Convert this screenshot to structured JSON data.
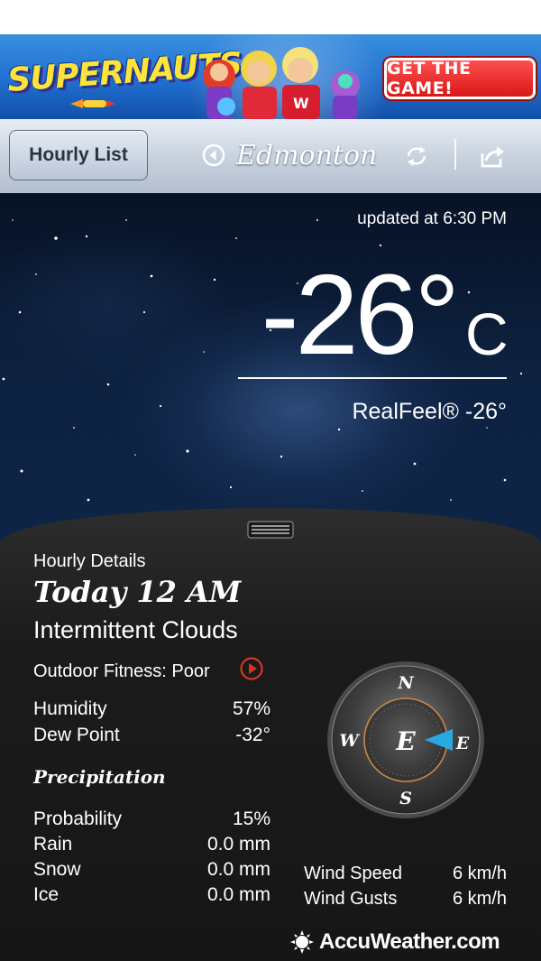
{
  "ad": {
    "brand": "SUPERNAUTS",
    "cta_label": "GET THE GAME!"
  },
  "nav": {
    "hourly_list_label": "Hourly List",
    "city": "Edmonton",
    "icons": [
      "back-icon",
      "refresh-icon",
      "share-icon"
    ]
  },
  "current": {
    "updated": "updated at 6:30 PM",
    "temperature": "-26°",
    "unit": "C",
    "realfeel": "RealFeel® -26°"
  },
  "details": {
    "section_label": "Hourly Details",
    "time": "Today 12 AM",
    "condition": "Intermittent Clouds",
    "outdoor_fitness": "Outdoor Fitness: Poor",
    "humidity": {
      "label": "Humidity",
      "value": "57%"
    },
    "dew_point": {
      "label": "Dew Point",
      "value": "-32°"
    },
    "precipitation": {
      "title": "Precipitation",
      "probability": {
        "label": "Probability",
        "value": "15%"
      },
      "rain": {
        "label": "Rain",
        "value": "0.0 mm"
      },
      "snow": {
        "label": "Snow",
        "value": "0.0 mm"
      },
      "ice": {
        "label": "Ice",
        "value": "0.0 mm"
      }
    }
  },
  "wind": {
    "compass": {
      "n": "N",
      "s": "S",
      "e": "E",
      "w": "W",
      "direction": "E"
    },
    "speed": {
      "label": "Wind Speed",
      "value": "6 km/h"
    },
    "gusts": {
      "label": "Wind Gusts",
      "value": "6 km/h"
    }
  },
  "footer": {
    "brand": "AccuWeather.com"
  },
  "colors": {
    "accent_red": "#d8351f",
    "pointer_blue": "#2aa8e0",
    "compass_ring": "#c9884a"
  }
}
